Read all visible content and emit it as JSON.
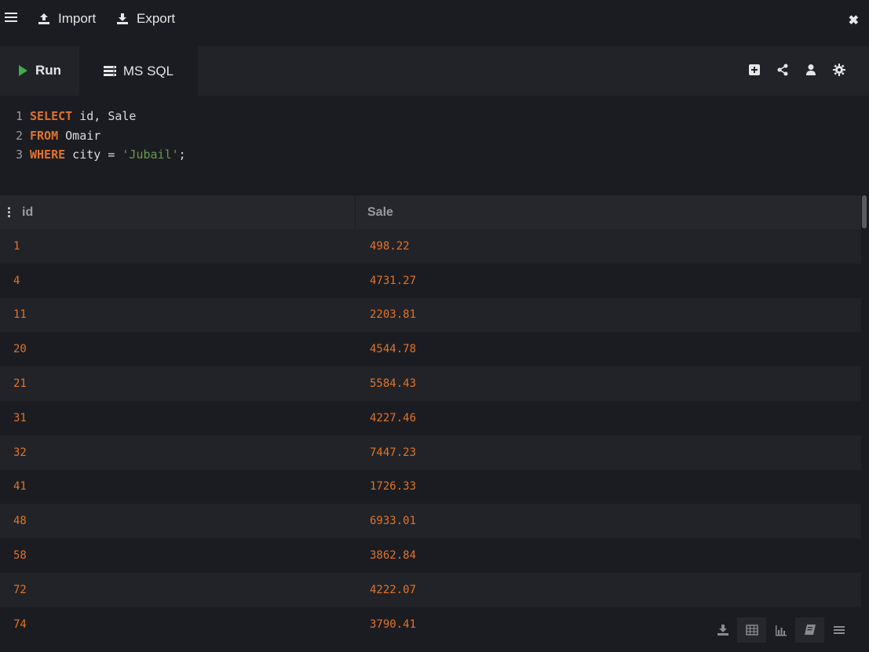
{
  "topbar": {
    "import_label": "Import",
    "export_label": "Export",
    "menu_icon": "hamburger-icon",
    "close_icon": "close-icon"
  },
  "toolbar": {
    "run_label": "Run",
    "db_label": "MS SQL",
    "icons": [
      "add-icon",
      "share-icon",
      "user-icon",
      "gear-icon"
    ]
  },
  "editor": {
    "lines": [
      {
        "num": "1",
        "kw": "SELECT",
        "rest": " id, Sale"
      },
      {
        "num": "2",
        "kw": "FROM",
        "rest": " Omair"
      },
      {
        "num": "3",
        "kw": "WHERE",
        "rest": " city = ",
        "str": "'Jubail'",
        "end": ";"
      }
    ]
  },
  "results": {
    "columns": [
      "id",
      "Sale"
    ],
    "rows": [
      [
        "1",
        "498.22"
      ],
      [
        "4",
        "4731.27"
      ],
      [
        "11",
        "2203.81"
      ],
      [
        "20",
        "4544.78"
      ],
      [
        "21",
        "5584.43"
      ],
      [
        "31",
        "4227.46"
      ],
      [
        "32",
        "7447.23"
      ],
      [
        "41",
        "1726.33"
      ],
      [
        "48",
        "6933.01"
      ],
      [
        "58",
        "3862.84"
      ],
      [
        "72",
        "4222.07"
      ],
      [
        "74",
        "3790.41"
      ]
    ]
  },
  "view_icons": [
    "download-icon",
    "table-icon",
    "chart-icon",
    "book-icon",
    "list-icon"
  ],
  "colors": {
    "accent": "#e0732a",
    "run": "#3fae4a",
    "string": "#6a9a4e"
  }
}
